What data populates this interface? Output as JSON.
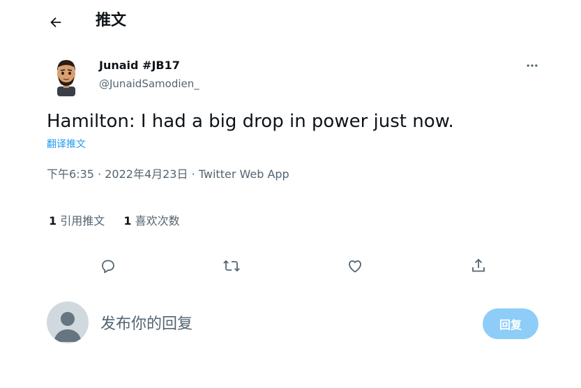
{
  "header": {
    "back_icon": "arrow-left-icon",
    "title": "推文"
  },
  "author": {
    "name": "Junaid #JB17",
    "handle": "@JunaidSamodien_"
  },
  "tweet": {
    "text": "Hamilton: I had a big drop in power just now.",
    "translate_label": "翻译推文",
    "time": "下午6:35",
    "date": "2022年4月23日",
    "separator": "·",
    "source": "Twitter Web App"
  },
  "stats": {
    "quotes_count": "1",
    "quotes_label": "引用推文",
    "likes_count": "1",
    "likes_label": "喜欢次数"
  },
  "actions": [
    "reply-icon",
    "retweet-icon",
    "like-icon",
    "share-icon"
  ],
  "reply": {
    "placeholder": "发布你的回复",
    "button_label": "回复"
  },
  "colors": {
    "accent": "#1d9bf0",
    "button_disabled": "#8ecdf8",
    "muted": "#536471"
  }
}
